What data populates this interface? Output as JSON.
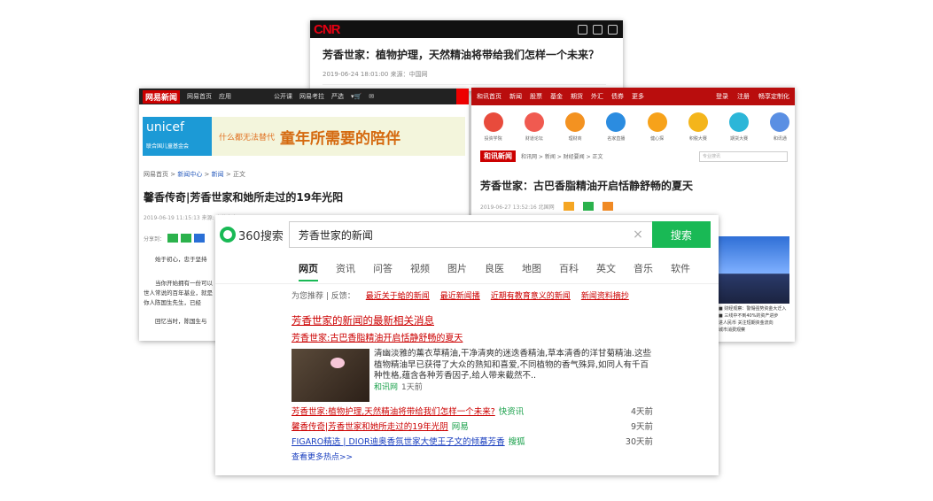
{
  "cnr": {
    "logo": "CNR",
    "headline": "芳香世家：植物护理，天然精油将带给我们怎样一个未来？",
    "meta": "2019-06-24 18:01:00   来源：中国网"
  },
  "netease": {
    "brand": "网易新闻",
    "nav": [
      "网易首页",
      "应用",
      "公开课",
      "网易考拉",
      "严选",
      "购物车",
      "邮箱"
    ],
    "unicef_name": "unicef",
    "unicef_sub": "联合国儿童基金会",
    "banner_small": "什么都无法替代",
    "banner_big": "童年所需要的陪伴",
    "crumb": [
      "网易首页",
      "新闻中心",
      "新闻",
      "正文"
    ],
    "title": "馨香传奇|芳香世家和她所走过的19年光阳",
    "date": "2019-06-19 11:15:13  来源: 商业中文网",
    "share_label": "分享到：",
    "paragraphs": [
      "始于初心，忠于坚持",
      "当你开始拥有一份可以",
      "世人常说的百年基业，就是",
      "你人陈国生先生，已经",
      "回忆当时，陈国生与"
    ]
  },
  "hexun": {
    "nav": [
      "和讯首页",
      "新闻",
      "股票",
      "基金",
      "期货",
      "外汇",
      "债券",
      "更多"
    ],
    "nav_right": [
      "登录",
      "注册",
      "畅享定制化"
    ],
    "icons": [
      "投资学院",
      "财道论坛",
      "理财商",
      "名家直播",
      "健心探",
      "积税大赛",
      "期货大赛",
      "和讯通"
    ],
    "logo": "和讯新闻",
    "crumb": "和讯网 > 新闻 > 财经要闻 > 正文",
    "search_placeholder": "专业搜讯",
    "title": "芳香世家：古巴香脂精油开启恬静舒畅的夏天",
    "date": "2019-06-27 13:52:16   北国网",
    "caption": [
      "■ 财经观察：警惕强势资金大迁入",
      "■ 三线中不到40%的资产进步",
      "进人民币 关注短期资金流向",
      "城市消费观察"
    ]
  },
  "s360": {
    "logo": "360搜索",
    "query": "芳香世家的新闻",
    "clear": "×",
    "search_btn": "搜索",
    "tabs": [
      "网页",
      "资讯",
      "问答",
      "视频",
      "图片",
      "良医",
      "地图",
      "百科",
      "英文",
      "音乐",
      "软件"
    ],
    "rec_label": "为您推荐 | 反馈：",
    "rec": [
      "最近关于蛤的新闻",
      "最近新闻播",
      "近期有教育意义的新闻",
      "新闻资料摘抄"
    ],
    "result_title": "芳香世家的新闻的最新相关消息",
    "top_item": "芳香世家:古巴香脂精油开启恬静舒畅的夏天",
    "desc": "清幽淡雅的薰衣草精油,干净清爽的迷迭香精油,草本清香的洋甘菊精油.这些植物精油早已获得了大众的熟知和喜爱,不同植物的香气殊异,如同人有千百种性格,蕴含各种芳香因子,给人带来截然不..",
    "desc_src": "和讯网",
    "desc_time": "1天前",
    "list": [
      {
        "t": "芳香世家:植物护理,天然精油将带给我们怎样一个未来?",
        "s": "快资讯",
        "d": "4天前"
      },
      {
        "t": "馨香传奇|芳香世家和她所走过的19年光阴",
        "s": "网易",
        "d": "9天前"
      },
      {
        "t": "FIGARO精选 | DIOR迪奥香氛世家大使王子文的倾慕芳香",
        "s": "搜狐",
        "d": "30天前"
      }
    ],
    "more": "查看更多热点>>"
  },
  "colors": {
    "accent_green": "#19b955",
    "link_red": "#cc0000",
    "hexun_red": "#b90d0d"
  }
}
